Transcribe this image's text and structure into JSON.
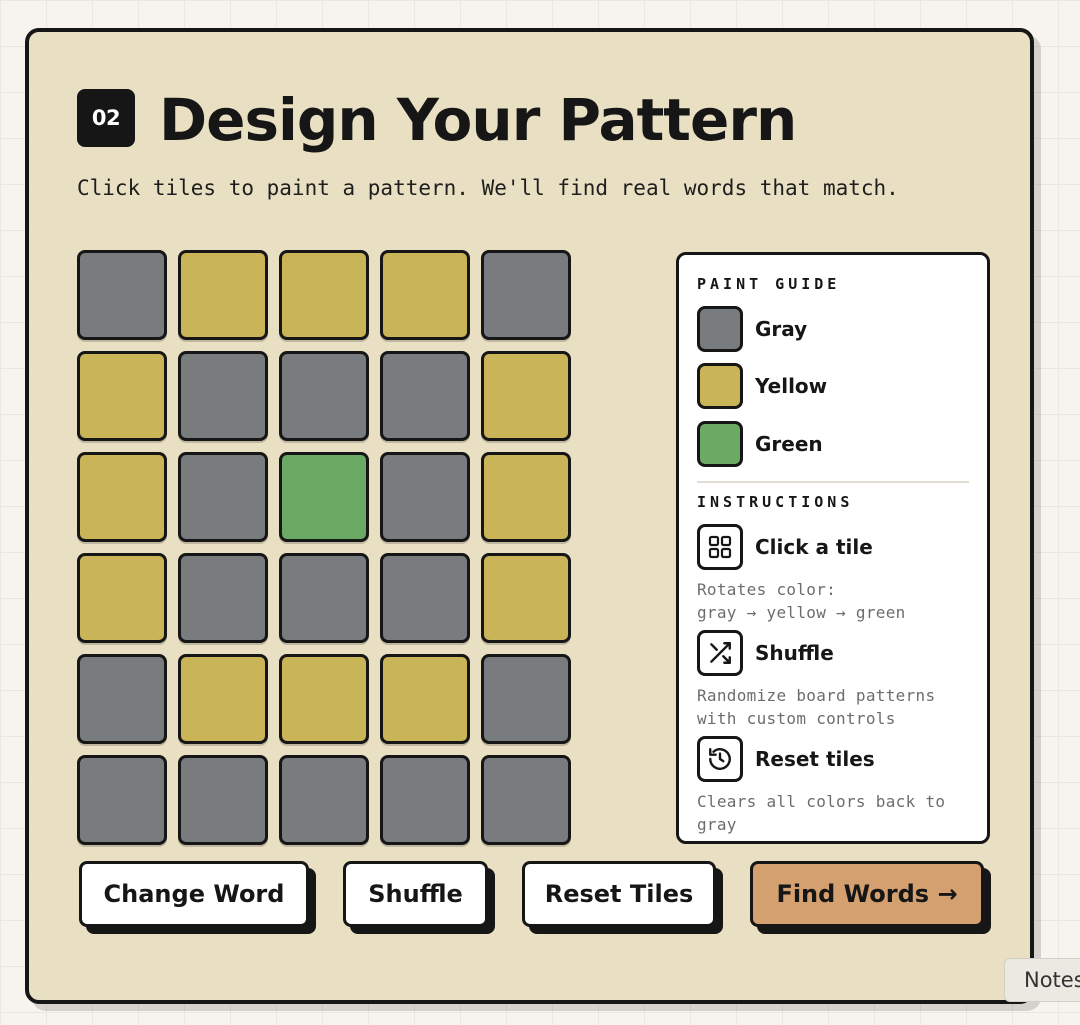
{
  "step_number": "02",
  "title": "Design Your Pattern",
  "subtitle": "Click tiles to paint a pattern. We'll find real words that match.",
  "colors": {
    "gray": "#787c7e",
    "yellow": "#c9b458",
    "green": "#6aaa64",
    "accent": "#d4a06f",
    "card": "#e9dfc2"
  },
  "board": {
    "rows": [
      [
        "gray",
        "yellow",
        "yellow",
        "yellow",
        "gray"
      ],
      [
        "yellow",
        "gray",
        "gray",
        "gray",
        "yellow"
      ],
      [
        "yellow",
        "gray",
        "green",
        "gray",
        "yellow"
      ],
      [
        "yellow",
        "gray",
        "gray",
        "gray",
        "yellow"
      ],
      [
        "gray",
        "yellow",
        "yellow",
        "yellow",
        "gray"
      ],
      [
        "gray",
        "gray",
        "gray",
        "gray",
        "gray"
      ]
    ]
  },
  "paint_guide": {
    "title": "PAINT GUIDE",
    "items": [
      {
        "label": "Gray",
        "color": "gray"
      },
      {
        "label": "Yellow",
        "color": "yellow"
      },
      {
        "label": "Green",
        "color": "green"
      }
    ]
  },
  "instructions": {
    "title": "INSTRUCTIONS",
    "items": [
      {
        "icon": "grid-icon",
        "title": "Click a tile",
        "line1": "Rotates color:",
        "line2": "gray → yellow → green"
      },
      {
        "icon": "shuffle-icon",
        "title": "Shuffle",
        "line1": "Randomize board patterns",
        "line2": "with custom controls"
      },
      {
        "icon": "history-icon",
        "title": "Reset tiles",
        "line1": "Clears all colors back to",
        "line2": "gray"
      }
    ]
  },
  "buttons": {
    "change_word": "Change Word",
    "shuffle": "Shuffle",
    "reset_tiles": "Reset Tiles",
    "find_words": "Find Words →"
  },
  "notes_tab": "Notes"
}
